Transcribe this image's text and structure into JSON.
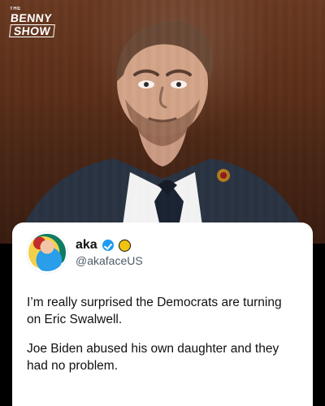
{
  "brand": {
    "the": "THE",
    "benny": "BENNY",
    "show": "SHOW"
  },
  "tweet": {
    "display_name": "aka",
    "handle": "@akafaceUS",
    "verified_icon": "blue-check-icon",
    "extra_badge_icon": "yellow-circle-badge-icon",
    "paragraphs": [
      "I’m really surprised the Democrats are turning on Eric Swalwell.",
      "Joe Biden abused his own daughter and they had no problem."
    ]
  },
  "colors": {
    "background": "#000000",
    "card": "#ffffff",
    "text": "#111111",
    "handle": "#4f5b66",
    "verified": "#1d9bf0",
    "wood": "#5c301a"
  }
}
